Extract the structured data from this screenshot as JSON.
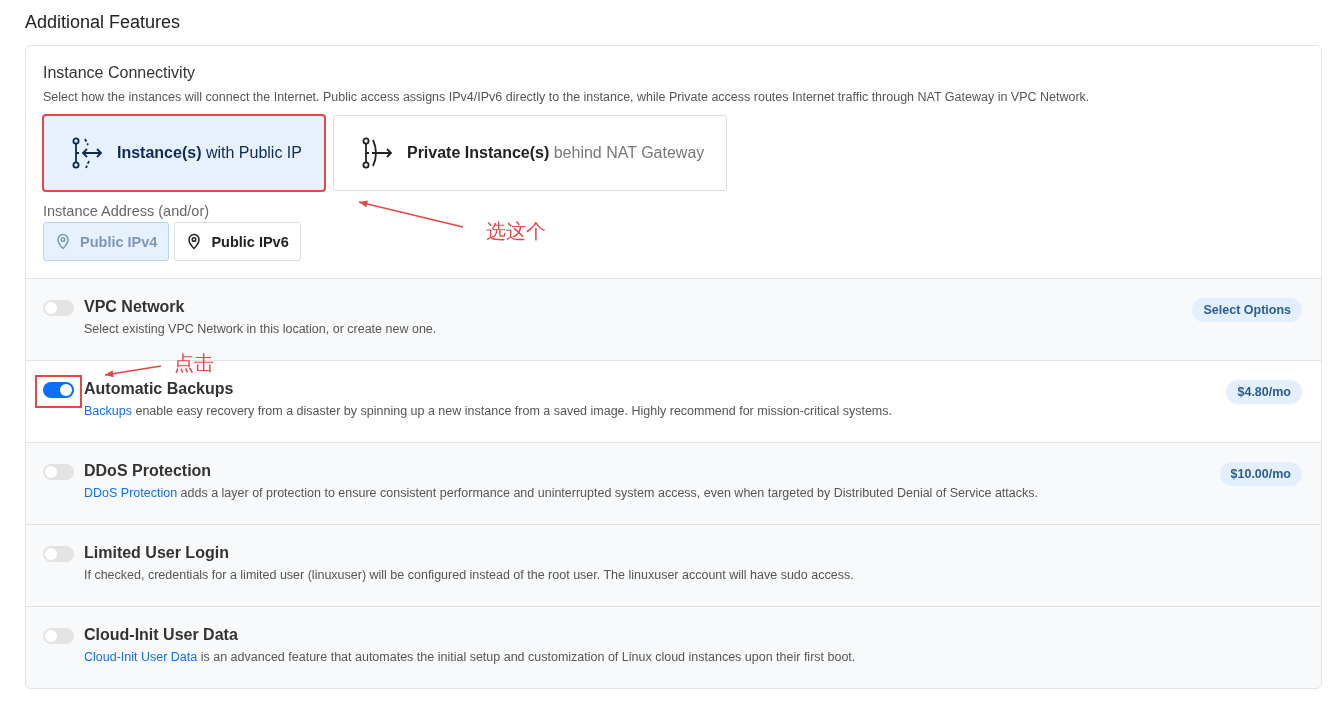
{
  "heading": "Additional Features",
  "connectivity": {
    "title": "Instance Connectivity",
    "description": "Select how the instances will connect the Internet. Public access assigns IPv4/IPv6 directly to the instance, while Private access routes Internet traffic through NAT Gateway in VPC Network.",
    "options": [
      {
        "kind": "public",
        "name": "Instance(s)",
        "suffix": "with Public IP",
        "selected": true,
        "annotation": "选这个"
      },
      {
        "kind": "private",
        "name": "Private Instance(s)",
        "suffix": "behind NAT Gateway",
        "selected": false
      }
    ],
    "address_label": "Instance Address (and/or)",
    "addresses": [
      {
        "label": "Public IPv4",
        "selected": true
      },
      {
        "label": "Public IPv6",
        "selected": false
      }
    ]
  },
  "features": [
    {
      "title": "VPC Network",
      "text": "Select existing VPC Network in this location, or create new one.",
      "on": false,
      "pill": "Select Options"
    },
    {
      "title": "Automatic Backups",
      "link": "Backups",
      "text": " enable easy recovery from a disaster by spinning up a new instance from a saved image. Highly recommend for mission-critical systems.",
      "on": true,
      "pill": "$4.80/mo",
      "annotation": "点击"
    },
    {
      "title": "DDoS Protection",
      "link": "DDoS Protection",
      "text": " adds a layer of protection to ensure consistent performance and uninterrupted system access, even when targeted by Distributed Denial of Service attacks.",
      "on": false,
      "pill": "$10.00/mo"
    },
    {
      "title": "Limited User Login",
      "text": "If checked, credentials for a limited user (linuxuser) will be configured instead of the root user. The linuxuser account will have sudo access.",
      "on": false
    },
    {
      "title": "Cloud-Init User Data",
      "link": "Cloud-Init User Data",
      "text": " is an advanced feature that automates the initial setup and customization of Linux cloud instances upon their first boot.",
      "on": false
    }
  ]
}
